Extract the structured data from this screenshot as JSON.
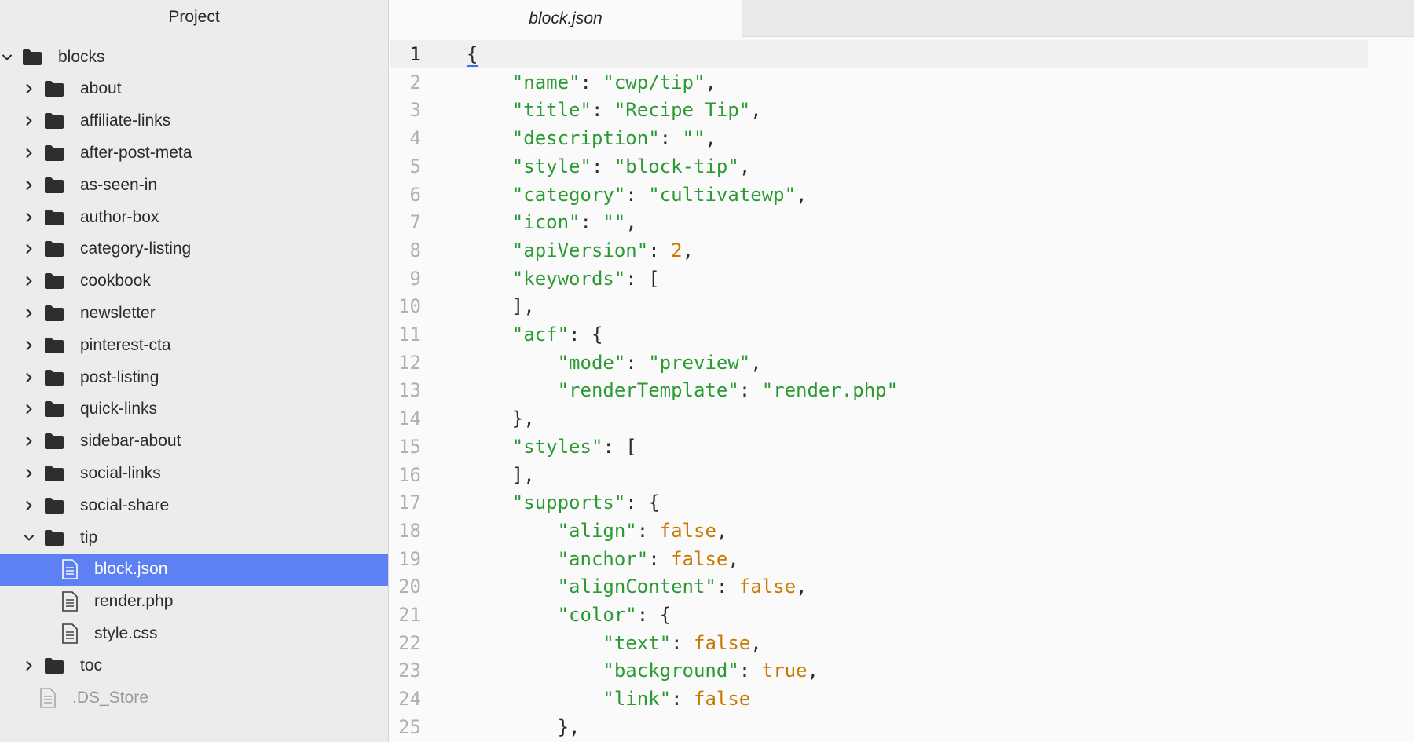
{
  "sidebar": {
    "title": "Project",
    "items": [
      {
        "label": "blocks",
        "kind": "folder",
        "expanded": true,
        "depth": 0
      },
      {
        "label": "about",
        "kind": "folder",
        "expanded": false,
        "depth": 1
      },
      {
        "label": "affiliate-links",
        "kind": "folder",
        "expanded": false,
        "depth": 1
      },
      {
        "label": "after-post-meta",
        "kind": "folder",
        "expanded": false,
        "depth": 1
      },
      {
        "label": "as-seen-in",
        "kind": "folder",
        "expanded": false,
        "depth": 1
      },
      {
        "label": "author-box",
        "kind": "folder",
        "expanded": false,
        "depth": 1
      },
      {
        "label": "category-listing",
        "kind": "folder",
        "expanded": false,
        "depth": 1
      },
      {
        "label": "cookbook",
        "kind": "folder",
        "expanded": false,
        "depth": 1
      },
      {
        "label": "newsletter",
        "kind": "folder",
        "expanded": false,
        "depth": 1
      },
      {
        "label": "pinterest-cta",
        "kind": "folder",
        "expanded": false,
        "depth": 1
      },
      {
        "label": "post-listing",
        "kind": "folder",
        "expanded": false,
        "depth": 1
      },
      {
        "label": "quick-links",
        "kind": "folder",
        "expanded": false,
        "depth": 1
      },
      {
        "label": "sidebar-about",
        "kind": "folder",
        "expanded": false,
        "depth": 1
      },
      {
        "label": "social-links",
        "kind": "folder",
        "expanded": false,
        "depth": 1
      },
      {
        "label": "social-share",
        "kind": "folder",
        "expanded": false,
        "depth": 1
      },
      {
        "label": "tip",
        "kind": "folder",
        "expanded": true,
        "depth": 1
      },
      {
        "label": "block.json",
        "kind": "file",
        "selected": true,
        "depth": 2
      },
      {
        "label": "render.php",
        "kind": "file",
        "depth": 2
      },
      {
        "label": "style.css",
        "kind": "file",
        "depth": 2
      },
      {
        "label": "toc",
        "kind": "folder",
        "expanded": false,
        "depth": 1
      },
      {
        "label": ".DS_Store",
        "kind": "file",
        "dim": true,
        "depth": 1
      }
    ]
  },
  "tabs": [
    {
      "label": "block.json",
      "active": true
    }
  ],
  "editor": {
    "active_line": 1,
    "lines": [
      [
        {
          "t": "p",
          "v": "{"
        }
      ],
      [
        {
          "t": "p",
          "v": "    "
        },
        {
          "t": "s",
          "v": "\"name\""
        },
        {
          "t": "p",
          "v": ": "
        },
        {
          "t": "s",
          "v": "\"cwp/tip\""
        },
        {
          "t": "p",
          "v": ","
        }
      ],
      [
        {
          "t": "p",
          "v": "    "
        },
        {
          "t": "s",
          "v": "\"title\""
        },
        {
          "t": "p",
          "v": ": "
        },
        {
          "t": "s",
          "v": "\"Recipe Tip\""
        },
        {
          "t": "p",
          "v": ","
        }
      ],
      [
        {
          "t": "p",
          "v": "    "
        },
        {
          "t": "s",
          "v": "\"description\""
        },
        {
          "t": "p",
          "v": ": "
        },
        {
          "t": "s",
          "v": "\"\""
        },
        {
          "t": "p",
          "v": ","
        }
      ],
      [
        {
          "t": "p",
          "v": "    "
        },
        {
          "t": "s",
          "v": "\"style\""
        },
        {
          "t": "p",
          "v": ": "
        },
        {
          "t": "s",
          "v": "\"block-tip\""
        },
        {
          "t": "p",
          "v": ","
        }
      ],
      [
        {
          "t": "p",
          "v": "    "
        },
        {
          "t": "s",
          "v": "\"category\""
        },
        {
          "t": "p",
          "v": ": "
        },
        {
          "t": "s",
          "v": "\"cultivatewp\""
        },
        {
          "t": "p",
          "v": ","
        }
      ],
      [
        {
          "t": "p",
          "v": "    "
        },
        {
          "t": "s",
          "v": "\"icon\""
        },
        {
          "t": "p",
          "v": ": "
        },
        {
          "t": "s",
          "v": "\"\""
        },
        {
          "t": "p",
          "v": ","
        }
      ],
      [
        {
          "t": "p",
          "v": "    "
        },
        {
          "t": "s",
          "v": "\"apiVersion\""
        },
        {
          "t": "p",
          "v": ": "
        },
        {
          "t": "k",
          "v": "2"
        },
        {
          "t": "p",
          "v": ","
        }
      ],
      [
        {
          "t": "p",
          "v": "    "
        },
        {
          "t": "s",
          "v": "\"keywords\""
        },
        {
          "t": "p",
          "v": ": ["
        }
      ],
      [
        {
          "t": "p",
          "v": "    ],"
        }
      ],
      [
        {
          "t": "p",
          "v": "    "
        },
        {
          "t": "s",
          "v": "\"acf\""
        },
        {
          "t": "p",
          "v": ": {"
        }
      ],
      [
        {
          "t": "p",
          "v": "        "
        },
        {
          "t": "s",
          "v": "\"mode\""
        },
        {
          "t": "p",
          "v": ": "
        },
        {
          "t": "s",
          "v": "\"preview\""
        },
        {
          "t": "p",
          "v": ","
        }
      ],
      [
        {
          "t": "p",
          "v": "        "
        },
        {
          "t": "s",
          "v": "\"renderTemplate\""
        },
        {
          "t": "p",
          "v": ": "
        },
        {
          "t": "s",
          "v": "\"render.php\""
        }
      ],
      [
        {
          "t": "p",
          "v": "    },"
        }
      ],
      [
        {
          "t": "p",
          "v": "    "
        },
        {
          "t": "s",
          "v": "\"styles\""
        },
        {
          "t": "p",
          "v": ": ["
        }
      ],
      [
        {
          "t": "p",
          "v": "    ],"
        }
      ],
      [
        {
          "t": "p",
          "v": "    "
        },
        {
          "t": "s",
          "v": "\"supports\""
        },
        {
          "t": "p",
          "v": ": {"
        }
      ],
      [
        {
          "t": "p",
          "v": "        "
        },
        {
          "t": "s",
          "v": "\"align\""
        },
        {
          "t": "p",
          "v": ": "
        },
        {
          "t": "k",
          "v": "false"
        },
        {
          "t": "p",
          "v": ","
        }
      ],
      [
        {
          "t": "p",
          "v": "        "
        },
        {
          "t": "s",
          "v": "\"anchor\""
        },
        {
          "t": "p",
          "v": ": "
        },
        {
          "t": "k",
          "v": "false"
        },
        {
          "t": "p",
          "v": ","
        }
      ],
      [
        {
          "t": "p",
          "v": "        "
        },
        {
          "t": "s",
          "v": "\"alignContent\""
        },
        {
          "t": "p",
          "v": ": "
        },
        {
          "t": "k",
          "v": "false"
        },
        {
          "t": "p",
          "v": ","
        }
      ],
      [
        {
          "t": "p",
          "v": "        "
        },
        {
          "t": "s",
          "v": "\"color\""
        },
        {
          "t": "p",
          "v": ": {"
        }
      ],
      [
        {
          "t": "p",
          "v": "            "
        },
        {
          "t": "s",
          "v": "\"text\""
        },
        {
          "t": "p",
          "v": ": "
        },
        {
          "t": "k",
          "v": "false"
        },
        {
          "t": "p",
          "v": ","
        }
      ],
      [
        {
          "t": "p",
          "v": "            "
        },
        {
          "t": "s",
          "v": "\"background\""
        },
        {
          "t": "p",
          "v": ": "
        },
        {
          "t": "k",
          "v": "true"
        },
        {
          "t": "p",
          "v": ","
        }
      ],
      [
        {
          "t": "p",
          "v": "            "
        },
        {
          "t": "s",
          "v": "\"link\""
        },
        {
          "t": "p",
          "v": ": "
        },
        {
          "t": "k",
          "v": "false"
        }
      ],
      [
        {
          "t": "p",
          "v": "        },"
        }
      ]
    ]
  },
  "colors": {
    "selection": "#5d80f5",
    "string": "#2a9a32",
    "literal": "#c87a00",
    "sidebar_bg": "#ececec"
  },
  "icons": {
    "folder": "folder-icon",
    "file": "file-icon",
    "chevron_right": "chevron-right-icon",
    "chevron_down": "chevron-down-icon"
  }
}
